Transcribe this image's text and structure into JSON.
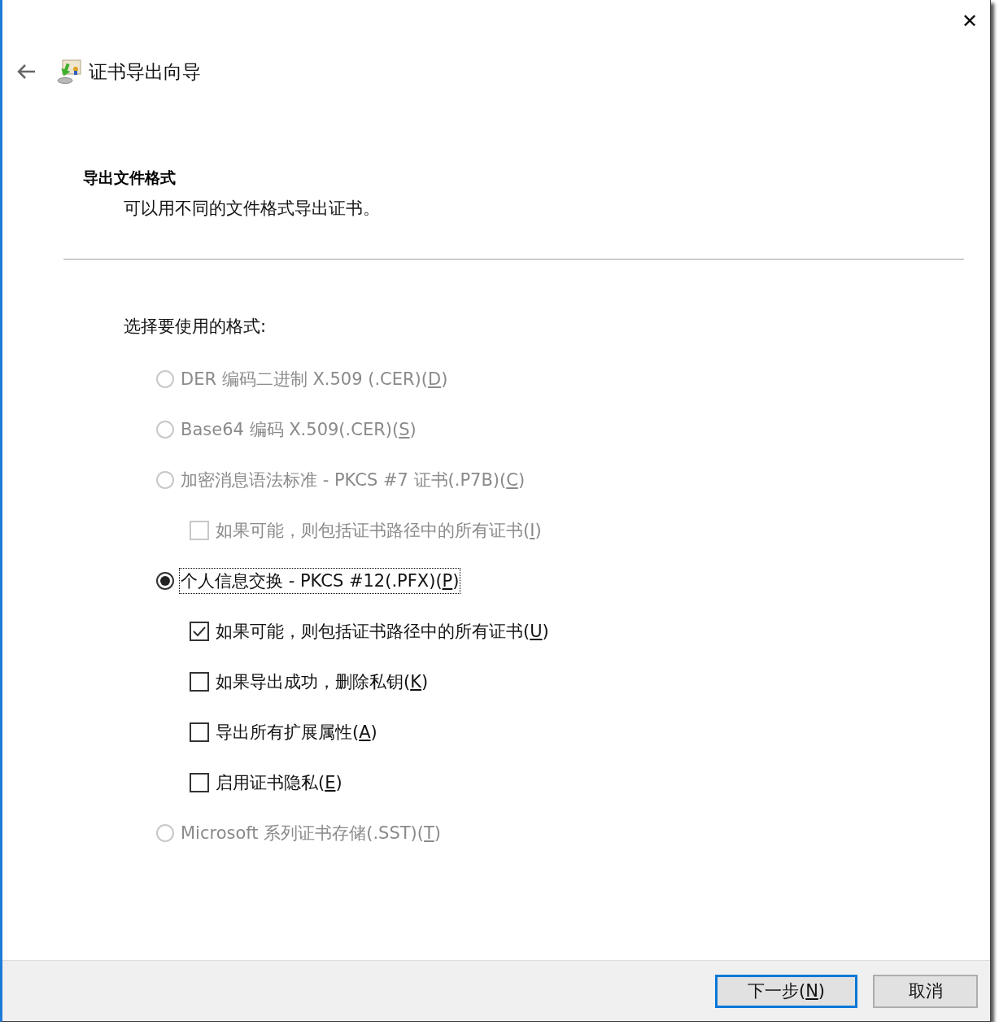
{
  "window": {
    "title": "证书导出向导",
    "close": "✕"
  },
  "section": {
    "title": "导出文件格式",
    "subtitle": "可以用不同的文件格式导出证书。"
  },
  "prompt": "选择要使用的格式:",
  "options": [
    {
      "kind": "radio",
      "label": "DER 编码二进制 X.509 (.CER)(",
      "key": "D",
      "label_end": ")",
      "selected": false,
      "disabled": true,
      "focused": false
    },
    {
      "kind": "radio",
      "label": "Base64 编码 X.509(.CER)(",
      "key": "S",
      "label_end": ")",
      "selected": false,
      "disabled": true,
      "focused": false
    },
    {
      "kind": "radio",
      "label": "加密消息语法标准 - PKCS #7 证书(.P7B)(",
      "key": "C",
      "label_end": ")",
      "selected": false,
      "disabled": true,
      "focused": false,
      "children": [
        {
          "kind": "checkbox",
          "label": "如果可能，则包括证书路径中的所有证书(",
          "key": "I",
          "label_end": ")",
          "checked": false,
          "disabled": true
        }
      ]
    },
    {
      "kind": "radio",
      "label": "个人信息交换 - PKCS #12(.PFX)(",
      "key": "P",
      "label_end": ")",
      "selected": true,
      "disabled": false,
      "focused": true,
      "children": [
        {
          "kind": "checkbox",
          "label": "如果可能，则包括证书路径中的所有证书(",
          "key": "U",
          "label_end": ")",
          "checked": true,
          "disabled": false
        },
        {
          "kind": "checkbox",
          "label": "如果导出成功，删除私钥(",
          "key": "K",
          "label_end": ")",
          "checked": false,
          "disabled": false
        },
        {
          "kind": "checkbox",
          "label": "导出所有扩展属性(",
          "key": "A",
          "label_end": ")",
          "checked": false,
          "disabled": false
        },
        {
          "kind": "checkbox",
          "label": "启用证书隐私(",
          "key": "E",
          "label_end": ")",
          "checked": false,
          "disabled": false
        }
      ]
    },
    {
      "kind": "radio",
      "label": "Microsoft 系列证书存储(.SST)(",
      "key": "T",
      "label_end": ")",
      "selected": false,
      "disabled": true,
      "focused": false
    }
  ],
  "buttons": [
    {
      "label": "下一步(",
      "key": "N",
      "label_end": ")",
      "default": true
    },
    {
      "label": "取消",
      "default": false
    }
  ]
}
